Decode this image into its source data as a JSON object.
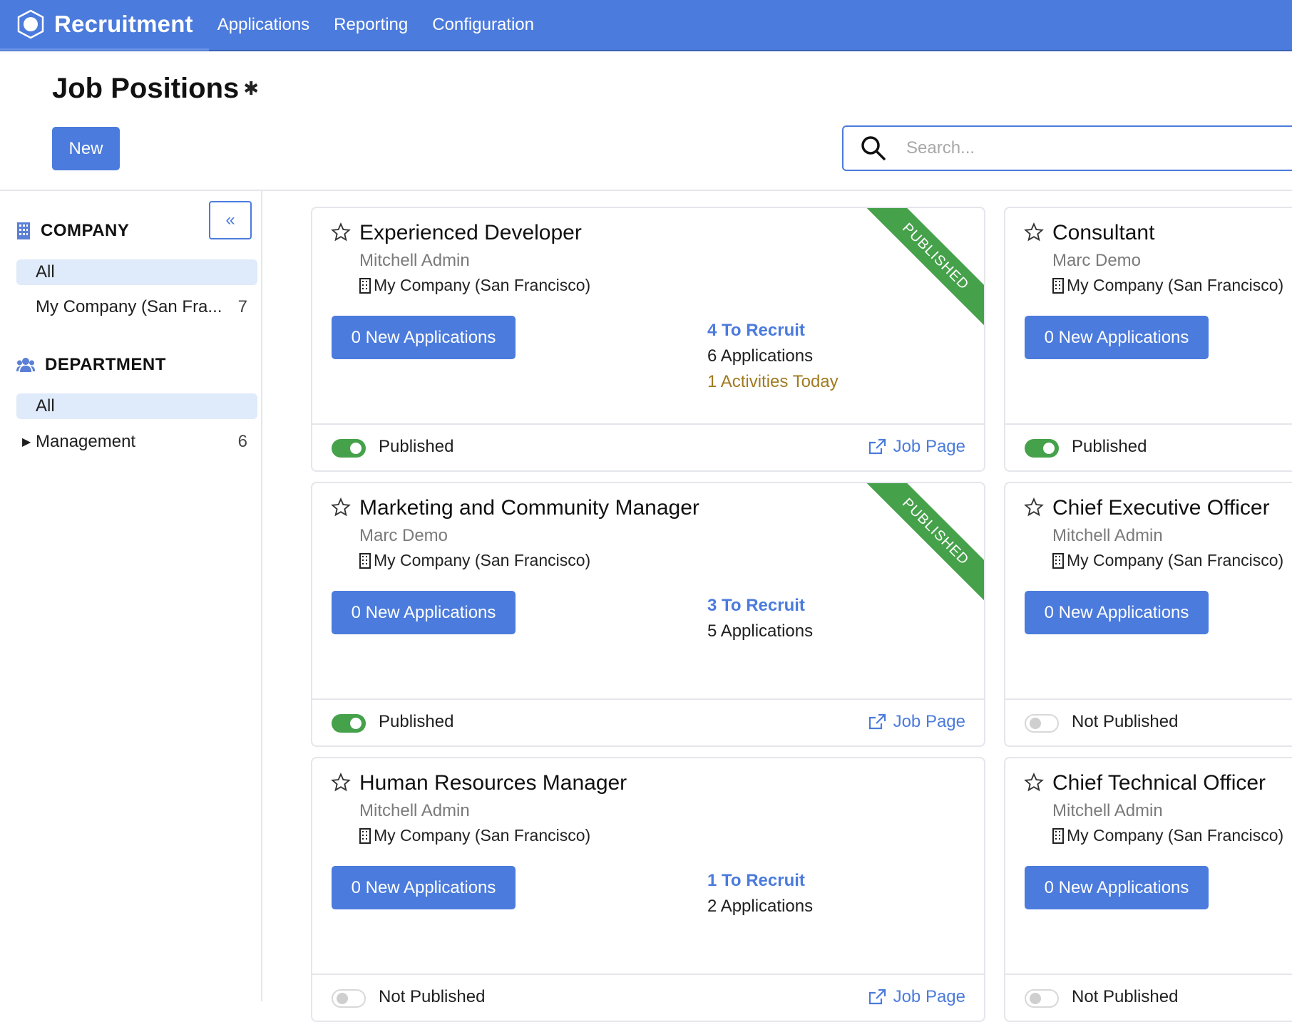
{
  "app": {
    "name": "Recruitment"
  },
  "nav": [
    "Applications",
    "Reporting",
    "Configuration"
  ],
  "page": {
    "title": "Job Positions",
    "new_label": "New"
  },
  "search": {
    "placeholder": "Search..."
  },
  "sidebar": {
    "company": {
      "title": "COMPANY",
      "items": [
        {
          "label": "All",
          "count": ""
        },
        {
          "label": "My Company (San Fra...",
          "count": "7"
        }
      ]
    },
    "department": {
      "title": "DEPARTMENT",
      "items": [
        {
          "label": "All",
          "count": ""
        },
        {
          "label": "Management",
          "count": "6"
        }
      ]
    }
  },
  "cards": [
    {
      "title": "Experienced Developer",
      "user": "Mitchell Admin",
      "company": "My Company (San Francisco)",
      "new_apps": "0 New Applications",
      "to_recruit": "4 To Recruit",
      "applications": "6 Applications",
      "activities": "1 Activities Today",
      "status": "Published",
      "published": true,
      "ribbon": "PUBLISHED",
      "job_page": "Job Page"
    },
    {
      "title": "Consultant",
      "user": "Marc Demo",
      "company": "My Company (San Francisco)",
      "new_apps": "0 New Applications",
      "status": "Published",
      "published": true
    },
    {
      "title": "Marketing and Community Manager",
      "user": "Marc Demo",
      "company": "My Company (San Francisco)",
      "new_apps": "0 New Applications",
      "to_recruit": "3 To Recruit",
      "applications": "5 Applications",
      "status": "Published",
      "published": true,
      "ribbon": "PUBLISHED",
      "job_page": "Job Page"
    },
    {
      "title": "Chief Executive Officer",
      "user": "Mitchell Admin",
      "company": "My Company (San Francisco)",
      "new_apps": "0 New Applications",
      "status": "Not Published",
      "published": false
    },
    {
      "title": "Human Resources Manager",
      "user": "Mitchell Admin",
      "company": "My Company (San Francisco)",
      "new_apps": "0 New Applications",
      "to_recruit": "1 To Recruit",
      "applications": "2 Applications",
      "status": "Not Published",
      "published": false,
      "job_page": "Job Page"
    },
    {
      "title": "Chief Technical Officer",
      "user": "Mitchell Admin",
      "company": "My Company (San Francisco)",
      "new_apps": "0 New Applications",
      "status": "Not Published",
      "published": false
    }
  ],
  "colors": {
    "primary": "#4b7bdc",
    "success": "#45a14a",
    "activity": "#a07a20"
  }
}
